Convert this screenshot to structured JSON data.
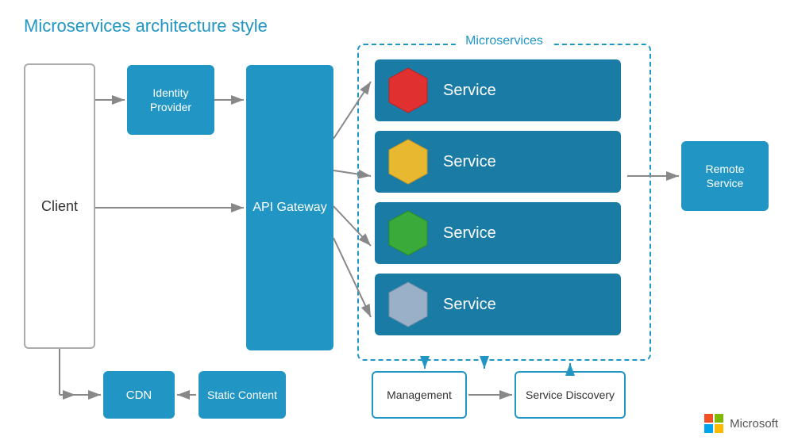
{
  "title": "Microservices architecture style",
  "microservices_label": "Microservices",
  "client_label": "Client",
  "identity_label": "Identity\nProvider",
  "gateway_label": "API\nGateway",
  "remote_label": "Remote\nService",
  "cdn_label": "CDN",
  "static_label": "Static\nContent",
  "management_label": "Management",
  "discovery_label": "Service\nDiscovery",
  "microsoft_label": "Microsoft",
  "services": [
    {
      "label": "Service",
      "hex_color": "#e03030"
    },
    {
      "label": "Service",
      "hex_color": "#e8b830"
    },
    {
      "label": "Service",
      "hex_color": "#3aaa3a"
    },
    {
      "label": "Service",
      "hex_color": "#9ab0c8"
    }
  ]
}
